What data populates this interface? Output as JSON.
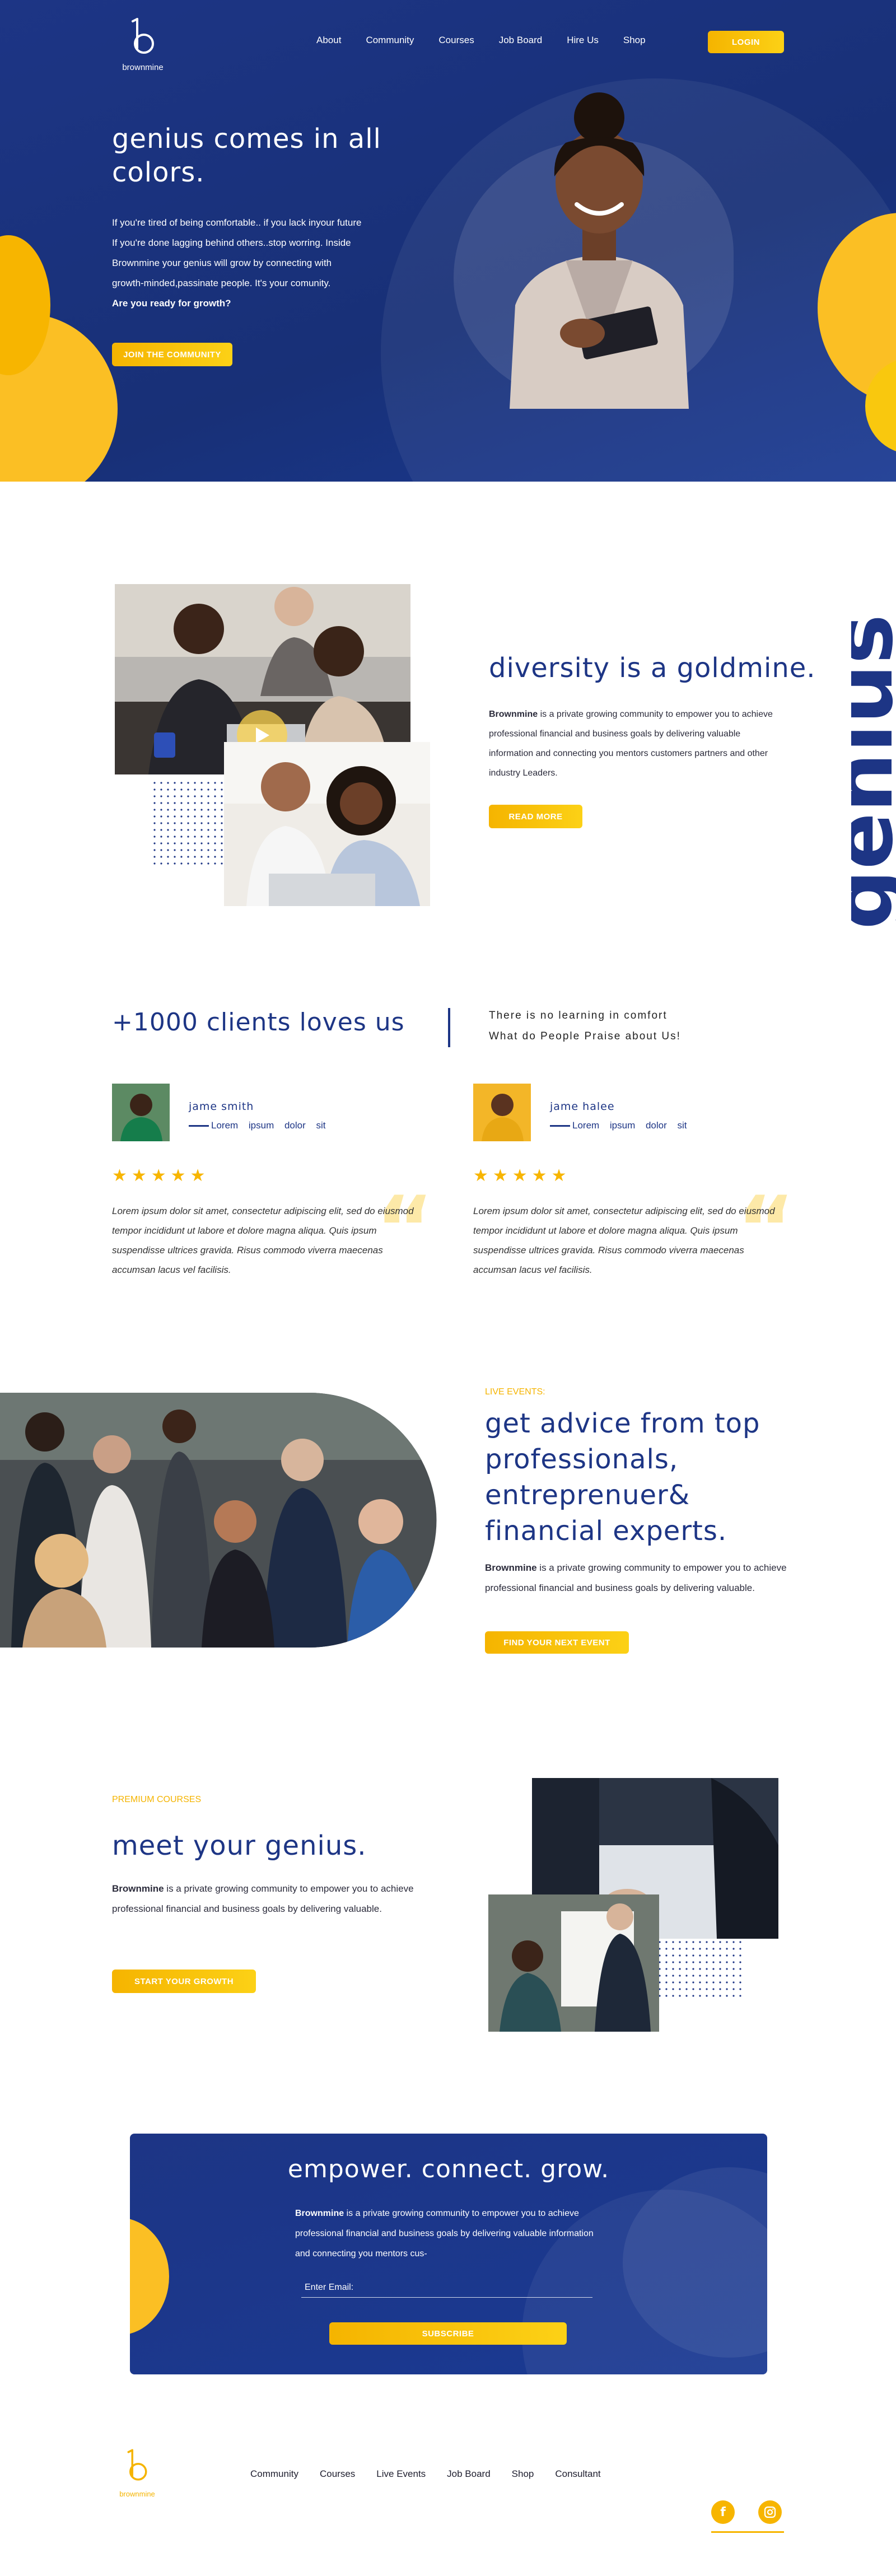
{
  "brand": {
    "name": "brownmine"
  },
  "nav": {
    "items": [
      "About",
      "Community",
      "Courses",
      "Job Board",
      "Hire Us",
      "Shop"
    ],
    "login_label": "LOGIN"
  },
  "hero": {
    "title": "genius comes in all colors.",
    "text_lines": [
      "If you're tired of being comfortable.. if you lack inyour future",
      "If you're done lagging behind others..stop worring. Inside",
      "Brownmine your genius will grow by connecting with",
      "growth-minded,passinate people. It's your comunity."
    ],
    "question": "Are you ready for growth?",
    "cta": "JOIN THE COMMUNITY"
  },
  "diversity": {
    "title": "diversity is a goldmine.",
    "brand_bold": "Brownmine",
    "text": " is a private growing community to empower you to achieve professional financial and business goals by delivering valuable information and connecting you mentors customers partners and other industry Leaders.",
    "cta": "READ MORE",
    "vertical_word": "genius"
  },
  "testimonials": {
    "title": "+1000 clients loves us",
    "tag_line1": "There is no learning in comfort",
    "tag_line2": "What do People Praise about Us!",
    "reviews": [
      {
        "name": "jame smith",
        "role": "Lorem ipsum dolor sit",
        "stars": "★★★★★",
        "quote": "Lorem ipsum dolor sit amet, consectetur adipiscing elit, sed do eiusmod tempor incididunt ut labore et dolore magna aliqua. Quis ipsum suspendisse ultrices gravida. Risus commodo viverra maecenas accumsan lacus vel facilisis."
      },
      {
        "name": "jame halee",
        "role": "Lorem ipsum dolor sit",
        "stars": "★★★★★",
        "quote": "Lorem ipsum dolor sit amet, consectetur adipiscing elit, sed do eiusmod tempor incididunt ut labore et dolore magna aliqua. Quis ipsum suspendisse ultrices gravida. Risus commodo viverra maecenas accumsan lacus vel facilisis."
      }
    ]
  },
  "events": {
    "tag": "LIVE EVENTS:",
    "title": "get advice from top professionals, entreprenuer& financial experts.",
    "brand_bold": "Brownmine",
    "text": " is a private growing community to empower you to achieve professional financial and business goals by delivering valuable.",
    "cta": "FIND YOUR NEXT EVENT"
  },
  "courses": {
    "tag": "PREMIUM COURSES",
    "title": "meet your genius.",
    "brand_bold": "Brownmine",
    "text": " is a private growing community to empower you to achieve professional financial and business goals by delivering valuable.",
    "cta": "START YOUR GROWTH"
  },
  "newsletter": {
    "title": "empower. connect. grow.",
    "brand_bold": "Brownmine",
    "text": " is a private growing community to empower you to achieve professional financial and business goals by delivering valuable information and connecting you mentors cus-",
    "email_placeholder": "Enter Email:",
    "cta": "SUBSCRIBE"
  },
  "footer": {
    "items": [
      "Community",
      "Courses",
      "Live Events",
      "Job Board",
      "Shop",
      "Consultant"
    ],
    "social": [
      "facebook-icon",
      "instagram-icon"
    ]
  },
  "colors": {
    "navy": "#1d3585",
    "gold": "#f7b500"
  }
}
